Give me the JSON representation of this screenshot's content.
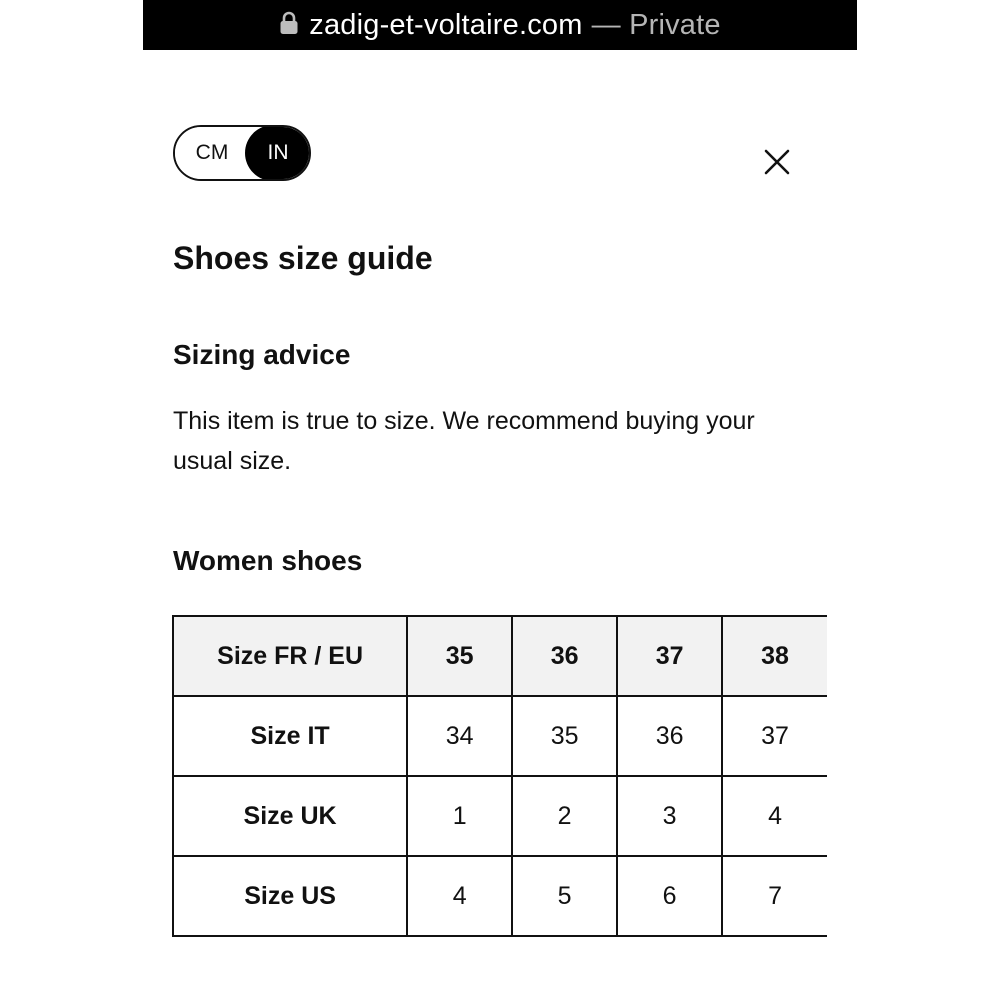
{
  "browser": {
    "url": "zadig-et-voltaire.com",
    "private_label": "— Private"
  },
  "unit_toggle": {
    "options": [
      "CM",
      "IN"
    ],
    "selected": "IN"
  },
  "close_icon": "close-icon",
  "title": "Shoes size guide",
  "sizing_advice": {
    "heading": "Sizing advice",
    "text": "This item is true to size. We recommend buying your usual size."
  },
  "women_shoes": {
    "heading": "Women shoes",
    "rows": [
      {
        "label": "Size FR / EU",
        "values": [
          "35",
          "36",
          "37",
          "38"
        ]
      },
      {
        "label": "Size IT",
        "values": [
          "34",
          "35",
          "36",
          "37"
        ]
      },
      {
        "label": "Size UK",
        "values": [
          "1",
          "2",
          "3",
          "4"
        ]
      },
      {
        "label": "Size US",
        "values": [
          "4",
          "5",
          "6",
          "7"
        ]
      }
    ]
  },
  "colors": {
    "header_bg": "#f2f2f2",
    "toggle_active_bg": "#000000",
    "border": "#111111"
  }
}
